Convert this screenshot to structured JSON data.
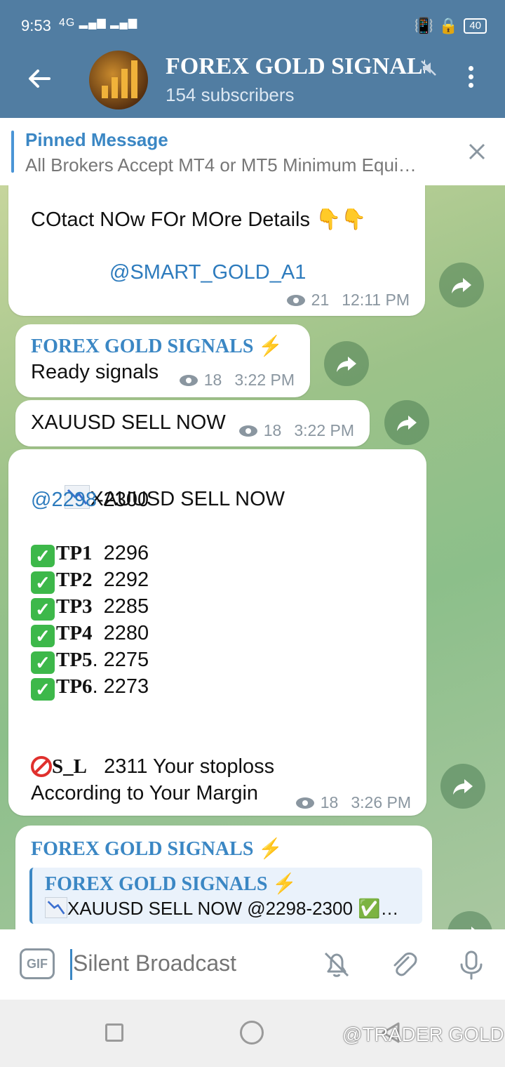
{
  "status_bar": {
    "time": "9:53",
    "signal": "4G",
    "battery": "40"
  },
  "header": {
    "title": "FOREX GOLD SIGNALS",
    "subtitle": "154 subscribers"
  },
  "pinned": {
    "title": "Pinned Message",
    "text": "All Brokers Accept MT4 or MT5 Minimum Equi…"
  },
  "messages": [
    {
      "line1": "COtact NOw FOr MOre Details 👇👇",
      "link": "@SMART_GOLD_A1",
      "views": "21",
      "time": "12:11 PM"
    },
    {
      "sender": "FOREX GOLD SIGNALS ⚡",
      "text": "Ready signals",
      "views": "18",
      "time": "3:22 PM"
    },
    {
      "text": "XAUUSD SELL NOW",
      "views": "18",
      "time": "3:22 PM"
    },
    {
      "title": "XAUUSD SELL NOW",
      "price_link": "@2298",
      "price_rest": "-2300",
      "tp_labels": [
        "TP1",
        "TP2",
        "TP3",
        "TP4",
        "TP5",
        "TP6"
      ],
      "tp_values": [
        "  2296",
        "  2292",
        "  2285",
        "  2280",
        ". 2275",
        ". 2273"
      ],
      "sl_label": "S_L",
      "sl_text": "   2311 Your stoploss",
      "line_last": "According to Your Margin",
      "views": "18",
      "time": "3:26 PM"
    },
    {
      "sender": "FOREX GOLD SIGNALS ⚡",
      "quote_sender": "FOREX GOLD SIGNALS ⚡",
      "quote_text": "XAUUSD SELL NOW @2298-2300 ✅…"
    }
  ],
  "input": {
    "placeholder": "Silent Broadcast"
  },
  "watermark": "@TRADER GOLD",
  "colors": {
    "header": "#517da2",
    "link": "#2d7bbd",
    "sender": "#3b87c4"
  }
}
